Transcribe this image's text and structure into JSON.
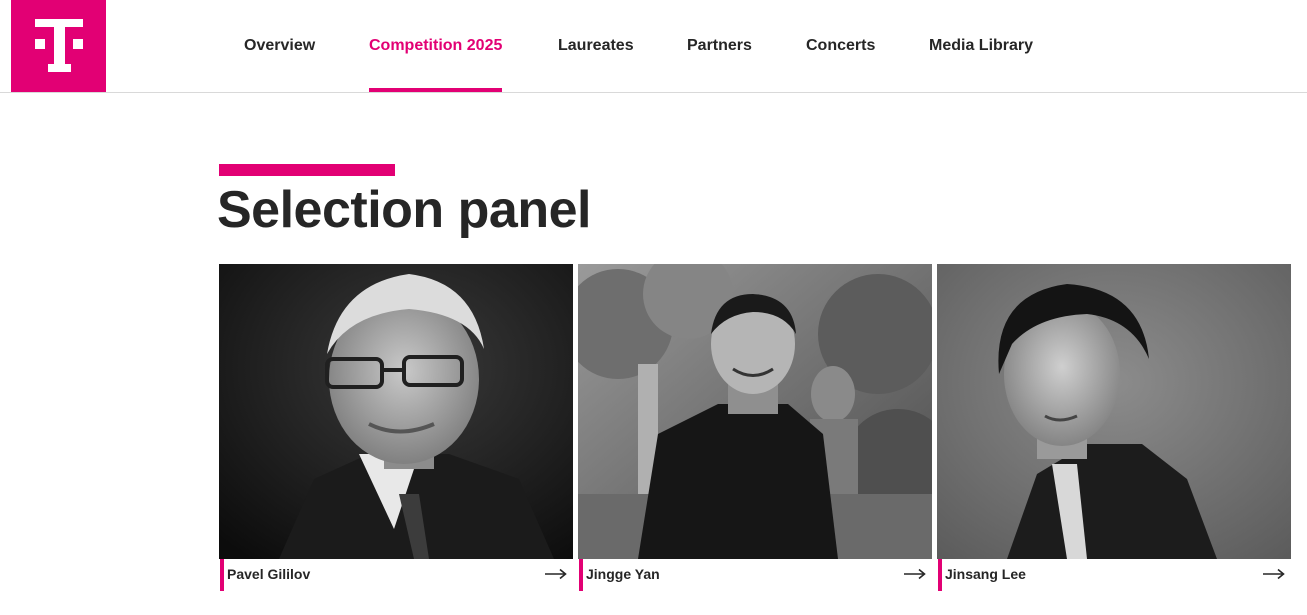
{
  "brand": {
    "logo_letter": "T",
    "accent_color": "#e20074"
  },
  "nav": {
    "items": [
      {
        "label": "Overview",
        "active": false
      },
      {
        "label": "Competition 2025",
        "active": true
      },
      {
        "label": "Laureates",
        "active": false
      },
      {
        "label": "Partners",
        "active": false
      },
      {
        "label": "Concerts",
        "active": false
      },
      {
        "label": "Media Library",
        "active": false
      }
    ]
  },
  "main": {
    "title": "Selection panel",
    "panel": [
      {
        "name": "Pavel Gililov",
        "icon": "arrow-right-icon"
      },
      {
        "name": "Jingge Yan",
        "icon": "arrow-right-icon"
      },
      {
        "name": "Jinsang Lee",
        "icon": "arrow-right-icon"
      }
    ]
  }
}
